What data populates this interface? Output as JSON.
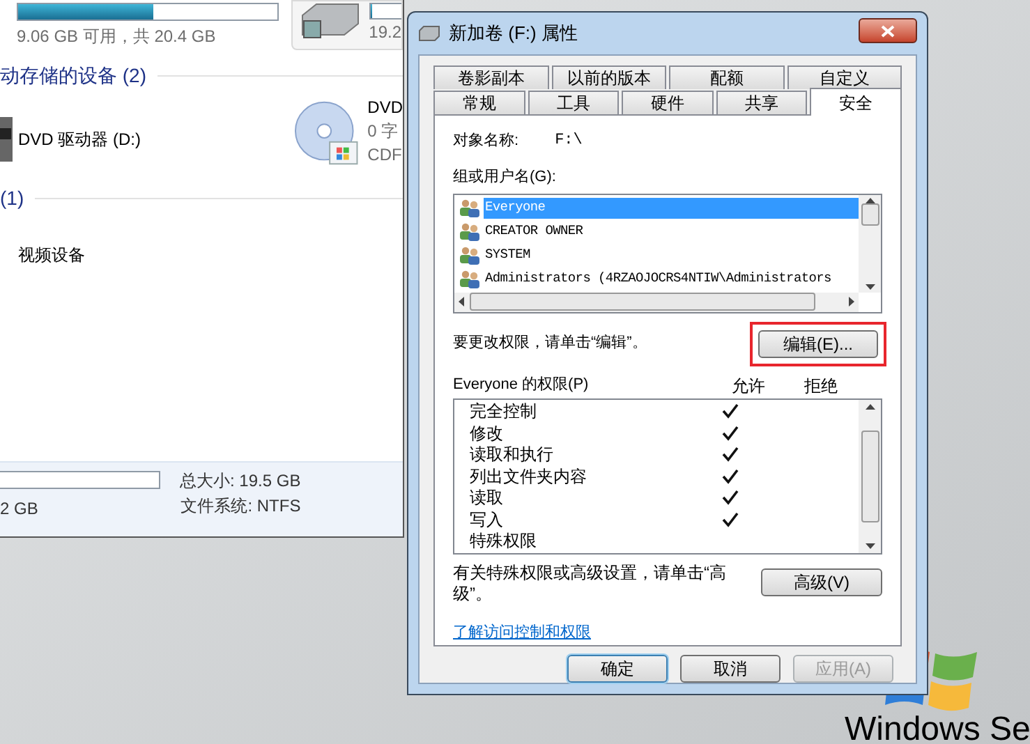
{
  "explorer": {
    "drive_top": {
      "level": 0.52,
      "free_text": "9.06 GB 可用，共 20.4 GB"
    },
    "drive_top_right": {
      "level": 0.08,
      "text": "19.2"
    },
    "section_removable": "动存储的设备 (2)",
    "dvd_drive": "DVD 驱动器 (D:)",
    "dvd_right": [
      "DVD",
      "0 字",
      "CDF"
    ],
    "section_other": "(1)",
    "video_device": "视频设备",
    "details": {
      "left_text": "2 GB",
      "total": "总大小: 19.5 GB",
      "filesystem": "文件系统: NTFS"
    }
  },
  "dialog": {
    "title": "新加卷 (F:) 属性",
    "tab_rows": [
      [
        {
          "label": "卷影副本",
          "selected": false
        },
        {
          "label": "以前的版本",
          "selected": false
        },
        {
          "label": "配额",
          "selected": false
        },
        {
          "label": "自定义",
          "selected": false
        }
      ],
      [
        {
          "label": "常规",
          "selected": false
        },
        {
          "label": "工具",
          "selected": false
        },
        {
          "label": "硬件",
          "selected": false
        },
        {
          "label": "共享",
          "selected": false
        },
        {
          "label": "安全",
          "selected": true
        }
      ]
    ],
    "object_label": "对象名称:",
    "object_value": "F:\\",
    "groups_label": "组或用户名(G):",
    "groups": [
      {
        "name": "Everyone",
        "selected": true
      },
      {
        "name": "CREATOR OWNER",
        "selected": false
      },
      {
        "name": "SYSTEM",
        "selected": false
      },
      {
        "name": "Administrators (4RZAOJOCRS4NTIW\\Administrators",
        "selected": false
      }
    ],
    "edit_hint": "要更改权限，请单击“编辑”。",
    "edit_button": "编辑(E)...",
    "edit_highlighted": true,
    "perm_label": "Everyone 的权限(P)",
    "allow_header": "允许",
    "deny_header": "拒绝",
    "permissions": [
      {
        "name": "完全控制",
        "allow": true,
        "deny": false
      },
      {
        "name": "修改",
        "allow": true,
        "deny": false
      },
      {
        "name": "读取和执行",
        "allow": true,
        "deny": false
      },
      {
        "name": "列出文件夹内容",
        "allow": true,
        "deny": false
      },
      {
        "name": "读取",
        "allow": true,
        "deny": false
      },
      {
        "name": "写入",
        "allow": true,
        "deny": false
      },
      {
        "name": "特殊权限",
        "allow": false,
        "deny": false
      }
    ],
    "advanced_hint": "有关特殊权限或高级设置，请单击“高级”。",
    "advanced_button": "高级(V)",
    "link": "了解访问控制和权限",
    "buttons": [
      {
        "label": "确定",
        "kind": "default",
        "disabled": false
      },
      {
        "label": "取消",
        "kind": "normal",
        "disabled": false
      },
      {
        "label": "应用(A)",
        "kind": "normal",
        "disabled": true
      }
    ]
  },
  "desktop": {
    "brand_text": "Windows Se"
  }
}
